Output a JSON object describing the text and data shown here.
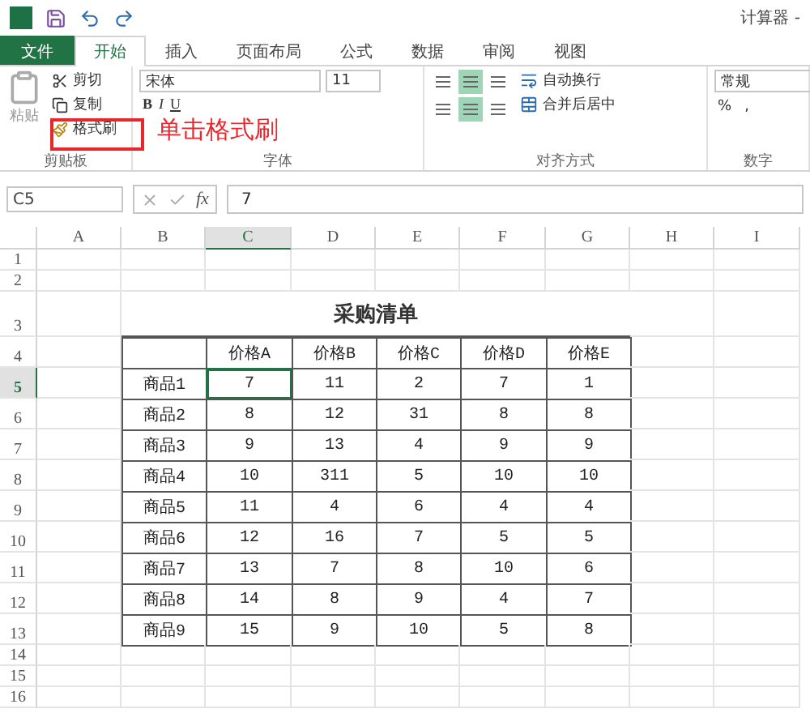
{
  "window": {
    "title": "计算器 -"
  },
  "tabs": [
    {
      "label": "文件",
      "kind": "file",
      "selected": false
    },
    {
      "label": "开始",
      "kind": "tab",
      "selected": true
    },
    {
      "label": "插入",
      "kind": "tab",
      "selected": false
    },
    {
      "label": "页面布局",
      "kind": "tab",
      "selected": false
    },
    {
      "label": "公式",
      "kind": "tab",
      "selected": false
    },
    {
      "label": "数据",
      "kind": "tab",
      "selected": false
    },
    {
      "label": "审阅",
      "kind": "tab",
      "selected": false
    },
    {
      "label": "视图",
      "kind": "tab",
      "selected": false
    }
  ],
  "ribbon": {
    "clipboard": {
      "paste": "粘贴",
      "cut": "剪切",
      "copy": "复制",
      "format_painter": "格式刷",
      "label": "剪贴板"
    },
    "font": {
      "font_name": "宋体",
      "font_size": "11",
      "bold": "B",
      "italic": "I",
      "underline": "U",
      "label": "字体"
    },
    "alignment": {
      "top_row": [
        {
          "selected": false
        },
        {
          "selected": true
        },
        {
          "selected": false
        }
      ],
      "bottom_row": [
        {
          "selected": false
        },
        {
          "selected": true
        },
        {
          "selected": false
        }
      ],
      "wrap": "自动换行",
      "merge": "合并后居中",
      "label": "对齐方式"
    },
    "number": {
      "format": "常规",
      "percent": "%",
      "comma": ",",
      "label": "数字"
    }
  },
  "annotation": {
    "text": "单击格式刷"
  },
  "formula_bar": {
    "name_box": "C5",
    "fx": "fx",
    "value": "7"
  },
  "sheet": {
    "column_headers": [
      {
        "label": "A",
        "selected": false
      },
      {
        "label": "B",
        "selected": false
      },
      {
        "label": "C",
        "selected": true
      },
      {
        "label": "D",
        "selected": false
      },
      {
        "label": "E",
        "selected": false
      },
      {
        "label": "F",
        "selected": false
      },
      {
        "label": "G",
        "selected": false
      },
      {
        "label": "H",
        "selected": false
      },
      {
        "label": "I",
        "selected": false
      }
    ],
    "row_numbers": [
      {
        "label": "1",
        "selected": false
      },
      {
        "label": "2",
        "selected": false
      },
      {
        "label": "3",
        "selected": false
      },
      {
        "label": "4",
        "selected": false
      },
      {
        "label": "5",
        "selected": true
      },
      {
        "label": "6",
        "selected": false
      },
      {
        "label": "7",
        "selected": false
      },
      {
        "label": "8",
        "selected": false
      },
      {
        "label": "9",
        "selected": false
      },
      {
        "label": "10",
        "selected": false
      },
      {
        "label": "11",
        "selected": false
      },
      {
        "label": "12",
        "selected": false
      },
      {
        "label": "13",
        "selected": false
      },
      {
        "label": "14",
        "selected": false
      },
      {
        "label": "15",
        "selected": false
      },
      {
        "label": "16",
        "selected": false
      }
    ],
    "table": {
      "title": "采购清单",
      "headers": [
        "价格A",
        "价格B",
        "价格C",
        "价格D",
        "价格E"
      ],
      "rows": [
        {
          "label": "商品1",
          "cells": [
            {
              "value": "7",
              "selected": true
            },
            {
              "value": "11",
              "selected": false
            },
            {
              "value": "2",
              "selected": false
            },
            {
              "value": "7",
              "selected": false
            },
            {
              "value": "1",
              "selected": false
            }
          ]
        },
        {
          "label": "商品2",
          "cells": [
            {
              "value": "8",
              "selected": false
            },
            {
              "value": "12",
              "selected": false
            },
            {
              "value": "31",
              "selected": false
            },
            {
              "value": "8",
              "selected": false
            },
            {
              "value": "8",
              "selected": false
            }
          ]
        },
        {
          "label": "商品3",
          "cells": [
            {
              "value": "9",
              "selected": false
            },
            {
              "value": "13",
              "selected": false
            },
            {
              "value": "4",
              "selected": false
            },
            {
              "value": "9",
              "selected": false
            },
            {
              "value": "9",
              "selected": false
            }
          ]
        },
        {
          "label": "商品4",
          "cells": [
            {
              "value": "10",
              "selected": false
            },
            {
              "value": "311",
              "selected": false
            },
            {
              "value": "5",
              "selected": false
            },
            {
              "value": "10",
              "selected": false
            },
            {
              "value": "10",
              "selected": false
            }
          ]
        },
        {
          "label": "商品5",
          "cells": [
            {
              "value": "11",
              "selected": false
            },
            {
              "value": "4",
              "selected": false
            },
            {
              "value": "6",
              "selected": false
            },
            {
              "value": "4",
              "selected": false
            },
            {
              "value": "4",
              "selected": false
            }
          ]
        },
        {
          "label": "商品6",
          "cells": [
            {
              "value": "12",
              "selected": false
            },
            {
              "value": "16",
              "selected": false
            },
            {
              "value": "7",
              "selected": false
            },
            {
              "value": "5",
              "selected": false
            },
            {
              "value": "5",
              "selected": false
            }
          ]
        },
        {
          "label": "商品7",
          "cells": [
            {
              "value": "13",
              "selected": false
            },
            {
              "value": "7",
              "selected": false
            },
            {
              "value": "8",
              "selected": false
            },
            {
              "value": "10",
              "selected": false
            },
            {
              "value": "6",
              "selected": false
            }
          ]
        },
        {
          "label": "商品8",
          "cells": [
            {
              "value": "14",
              "selected": false
            },
            {
              "value": "8",
              "selected": false
            },
            {
              "value": "9",
              "selected": false
            },
            {
              "value": "4",
              "selected": false
            },
            {
              "value": "7",
              "selected": false
            }
          ]
        },
        {
          "label": "商品9",
          "cells": [
            {
              "value": "15",
              "selected": false
            },
            {
              "value": "9",
              "selected": false
            },
            {
              "value": "10",
              "selected": false
            },
            {
              "value": "5",
              "selected": false
            },
            {
              "value": "8",
              "selected": false
            }
          ]
        }
      ]
    }
  }
}
